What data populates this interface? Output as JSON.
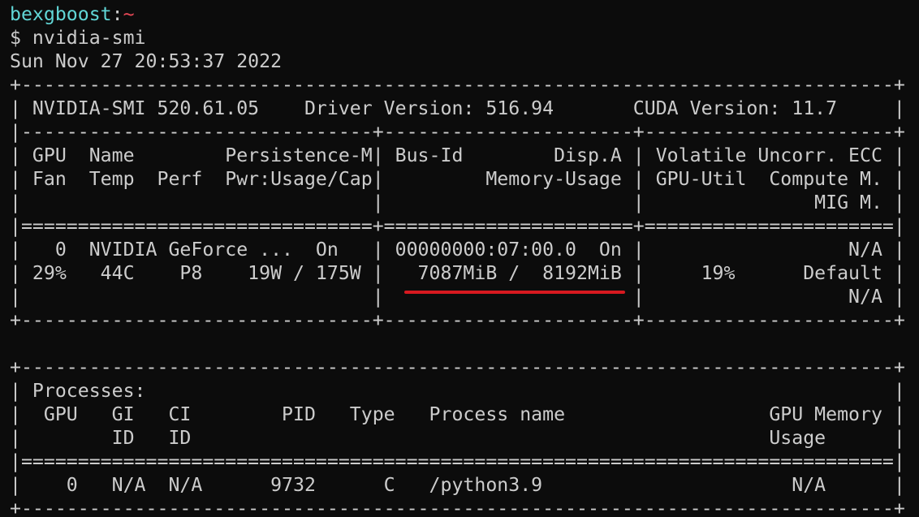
{
  "prompt": {
    "user": "bexgboost",
    "separator": ":",
    "path": "~"
  },
  "command": "$ nvidia-smi",
  "timestamp": "Sun Nov 27 20:53:37 2022",
  "gpu_table": {
    "border_top": "+-----------------------------------------------------------------------------+",
    "header": "| NVIDIA-SMI 520.61.05    Driver Version: 516.94       CUDA Version: 11.7     |",
    "divider": "|-------------------------------+----------------------+----------------------+",
    "col_header_1": "| GPU  Name        Persistence-M| Bus-Id        Disp.A | Volatile Uncorr. ECC |",
    "col_header_2": "| Fan  Temp  Perf  Pwr:Usage/Cap|         Memory-Usage | GPU-Util  Compute M. |",
    "col_header_3": "|                               |                      |               MIG M. |",
    "double_divider": "|===============================+======================+======================|",
    "row_1": "|   0  NVIDIA GeForce ...  On   | 00000000:07:00.0  On |                  N/A |",
    "row_2": "| 29%   44C    P8    19W / 175W |   7087MiB /  8192MiB |     19%      Default |",
    "row_3": "|                               |                      |                  N/A |",
    "border_bottom": "+-------------------------------+----------------------+----------------------+"
  },
  "gpu": {
    "index": "0",
    "name": "NVIDIA GeForce ...",
    "persistence_mode": "On",
    "bus_id": "00000000:07:00.0",
    "display_active": "On",
    "volatile_uncorr_ecc": "N/A",
    "fan": "29%",
    "temp": "44C",
    "perf": "P8",
    "power_usage": "19W",
    "power_cap": "175W",
    "memory_used": "7087MiB",
    "memory_total": "8192MiB",
    "gpu_util": "19%",
    "compute_mode": "Default",
    "mig_mode": "N/A"
  },
  "processes_table": {
    "border_top": "+-----------------------------------------------------------------------------+",
    "title": "| Processes:                                                                  |",
    "col_header_1": "|  GPU   GI   CI        PID   Type   Process name                  GPU Memory |",
    "col_header_2": "|        ID   ID                                                   Usage      |",
    "double_divider": "|=============================================================================|",
    "row_1": "|    0   N/A  N/A      9732      C   /python3.9                      N/A      |",
    "border_bottom": "+-----------------------------------------------------------------------------+"
  },
  "process": {
    "gpu": "0",
    "gi_id": "N/A",
    "ci_id": "N/A",
    "pid": "9732",
    "type": "C",
    "name": "/python3.9",
    "gpu_memory_usage": "N/A"
  },
  "colors": {
    "background": "#0c0c0c",
    "foreground": "#cccccc",
    "prompt_user": "#61d6d6",
    "prompt_path": "#e74856",
    "highlight_underline": "#d71920"
  }
}
